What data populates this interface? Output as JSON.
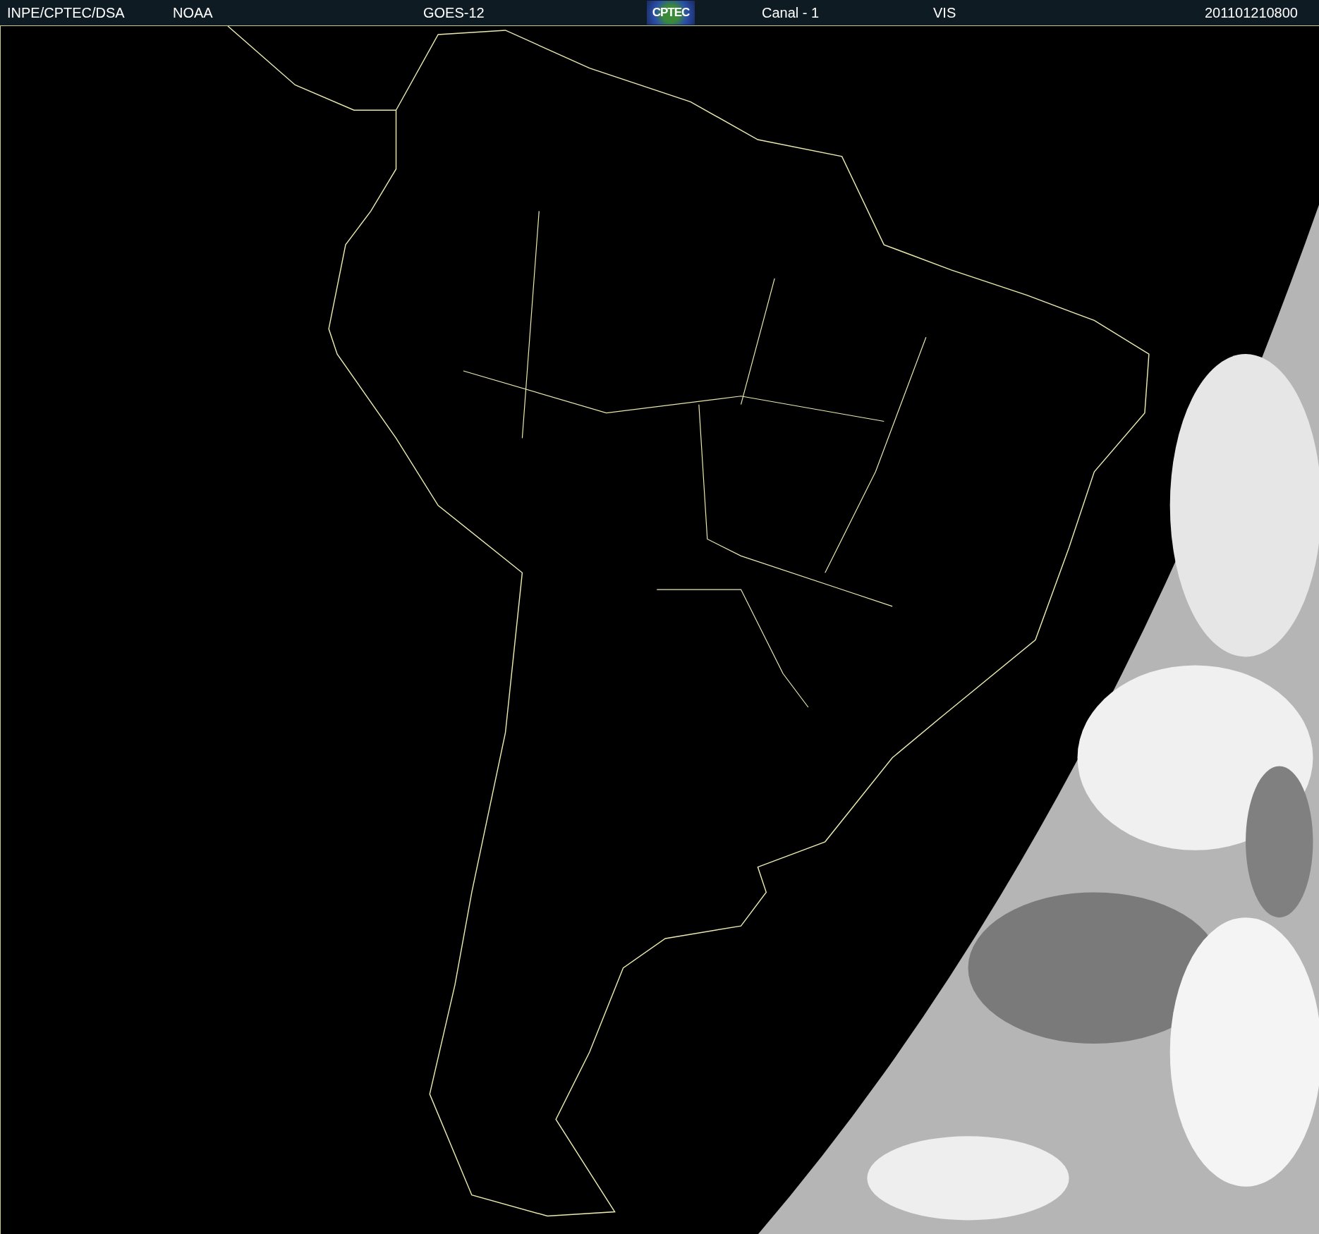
{
  "header": {
    "items": [
      {
        "kind": "text",
        "text": "INPE/CPTEC/DSA"
      },
      {
        "kind": "text",
        "text": "NOAA"
      },
      {
        "kind": "text",
        "text": "GOES-12"
      },
      {
        "kind": "logo",
        "text": "CPTEC"
      },
      {
        "kind": "text",
        "text": "Canal - 1"
      },
      {
        "kind": "text",
        "text": "VIS"
      },
      {
        "kind": "date",
        "text": "201101210800"
      }
    ]
  }
}
